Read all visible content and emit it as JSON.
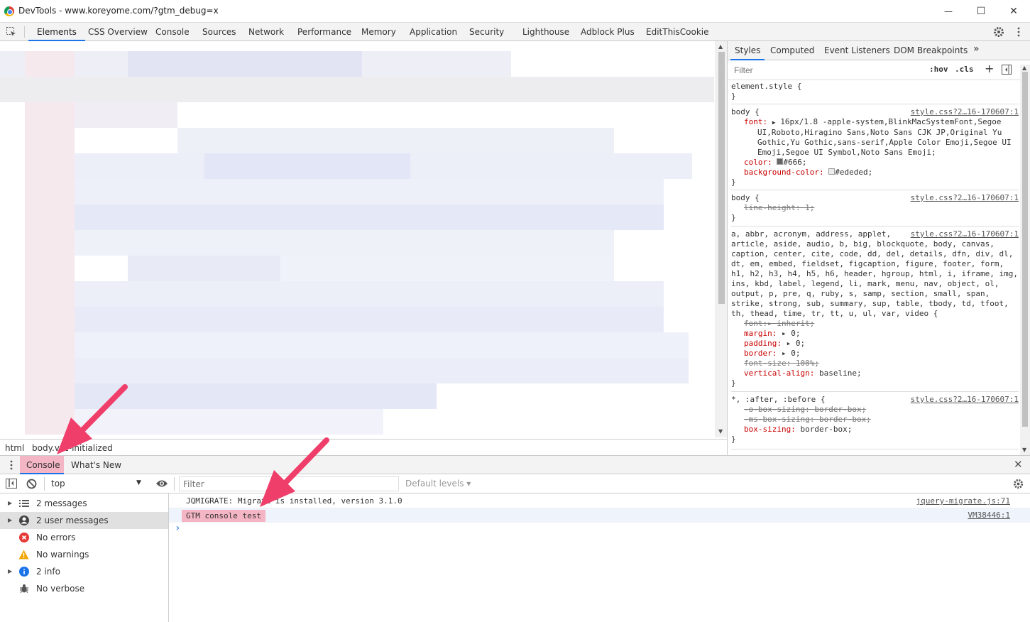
{
  "window": {
    "title": "DevTools - www.koreyome.com/?gtm_debug=x",
    "minimize": "—",
    "maximize": "☐",
    "close": "✕"
  },
  "tabs": [
    {
      "label": "Elements",
      "active": true
    },
    {
      "label": "CSS Overview"
    },
    {
      "label": "Console"
    },
    {
      "label": "Sources"
    },
    {
      "label": "Network"
    },
    {
      "label": "Performance"
    },
    {
      "label": "Memory"
    },
    {
      "label": "Application"
    },
    {
      "label": "Security"
    },
    {
      "label": "Lighthouse"
    },
    {
      "label": "Adblock Plus"
    },
    {
      "label": "EditThisCookie"
    }
  ],
  "breadcrumbs": [
    "html",
    "body.vsc-initialized"
  ],
  "styles": {
    "tabs": [
      "Styles",
      "Computed",
      "Event Listeners",
      "DOM Breakpoints",
      "»"
    ],
    "filter_placeholder": "Filter",
    "hov": ":hov",
    "cls": ".cls",
    "plus": "+",
    "rules": {
      "element_selector": "element.style {",
      "close": "}",
      "body1_selector": "body {",
      "body1_src": "style.css?2…16-170607:1",
      "body1_font_prop": "font:",
      "body1_font_val": "16px/1.8 -apple-system,BlinkMacSystemFont,Segoe",
      "body1_font_val2": "UI,Roboto,Hiragino Sans,Noto Sans CJK JP,Original Yu",
      "body1_font_val3": "Gothic,Yu Gothic,sans-serif,Apple Color Emoji,Segoe UI",
      "body1_font_val4": "Emoji,Segoe UI Symbol,Noto Sans Emoji;",
      "body1_color_prop": "color:",
      "body1_color_val": "#666;",
      "body1_bg_prop": "background-color:",
      "body1_bg_val": "#ededed;",
      "body2_selector": "body {",
      "body2_src": "style.css?2…16-170607:1",
      "body2_lh": "line-height: 1;",
      "reset_src": "style.css?2…16-170607:1",
      "reset_sel1": "a, abbr, acronym, address, applet,",
      "reset_sel2": "article, aside, audio, b, big, blockquote, body, canvas,",
      "reset_sel3": "caption, center, cite, code, dd, del, details, dfn, div, dl,",
      "reset_sel4": "dt, em, embed, fieldset, figcaption, figure, footer, form,",
      "reset_sel5": "h1, h2, h3, h4, h5, h6, header, hgroup, html, i, iframe, img,",
      "reset_sel6": "ins, kbd, label, legend, li, mark, menu, nav, object, ol,",
      "reset_sel7": "output, p, pre, q, ruby, s, samp, section, small, span,",
      "reset_sel8": "strike, strong, sub, summary, sup, table, tbody, td, tfoot,",
      "reset_sel9": "th, thead, time, tr, tt, u, ul, var, video {",
      "reset_font": "font:▸ inherit;",
      "reset_margin_prop": "margin:",
      "reset_margin_val": "▸ 0;",
      "reset_padding_prop": "padding:",
      "reset_padding_val": "▸ 0;",
      "reset_border_prop": "border:",
      "reset_border_val": "▸ 0;",
      "reset_fontsize": "font-size: 100%;",
      "reset_va_prop": "vertical-align:",
      "reset_va_val": "baseline;",
      "star_selector": "*, :after, :before {",
      "star_src": "style.css?2…16-170607:1",
      "star_o": "-o-box-sizing: border-box;",
      "star_ms": "-ms-box-sizing: border-box;",
      "star_bs_prop": "box-sizing:",
      "star_bs_val": "border-box;"
    }
  },
  "drawer": {
    "tabs": [
      {
        "label": "Console",
        "active": true
      },
      {
        "label": "What's New"
      }
    ],
    "context": "top",
    "filter_placeholder": "Filter",
    "levels": "Default levels ▾"
  },
  "console_sidebar": [
    {
      "label": "2 messages",
      "icon": "list-icon",
      "expandable": true
    },
    {
      "label": "2 user messages",
      "icon": "user-icon",
      "expandable": true,
      "selected": true
    },
    {
      "label": "No errors",
      "icon": "error-icon"
    },
    {
      "label": "No warnings",
      "icon": "warning-icon"
    },
    {
      "label": "2 info",
      "icon": "info-icon",
      "expandable": true
    },
    {
      "label": "No verbose",
      "icon": "bug-icon"
    }
  ],
  "console_messages": [
    {
      "text": "JQMIGRATE: Migrate is installed, version 3.1.0",
      "source": "jquery-migrate.js:71"
    },
    {
      "text": "GTM console test",
      "source": "VM38446:1",
      "highlighted": true
    }
  ],
  "prompt": "›",
  "colors": {
    "accent": "#1a73e8",
    "highlight": "#f4b5c4",
    "arrow": "#f03e6b"
  }
}
